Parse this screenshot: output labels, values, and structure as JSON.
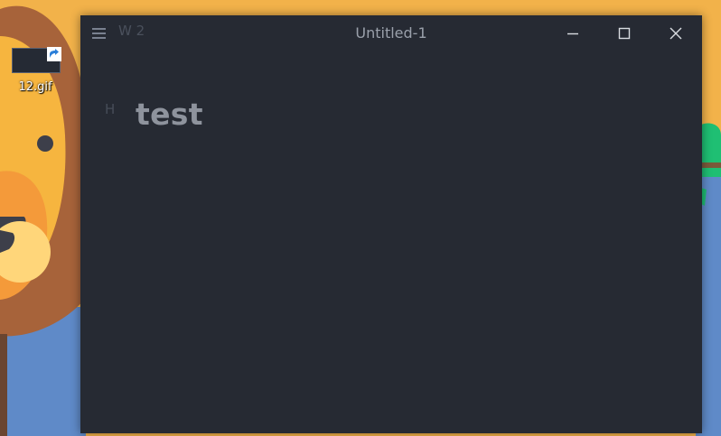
{
  "desktop": {
    "icons": [
      {
        "label": "12.gif",
        "icon": "gif-file-shortcut-icon"
      }
    ]
  },
  "window": {
    "title": "Untitled-1",
    "word_count": "W 2",
    "menu_icon": "hamburger-menu-icon",
    "controls": {
      "minimize_icon": "minimize-icon",
      "maximize_icon": "maximize-icon",
      "close_icon": "close-icon"
    }
  },
  "editor": {
    "heading_marker": "H1",
    "heading_text": "test"
  },
  "colors": {
    "window_bg": "#262a33",
    "wallpaper_orange": "#f2b24a",
    "wallpaper_blue": "#5f8ac8",
    "text_dim": "#8e939d"
  }
}
